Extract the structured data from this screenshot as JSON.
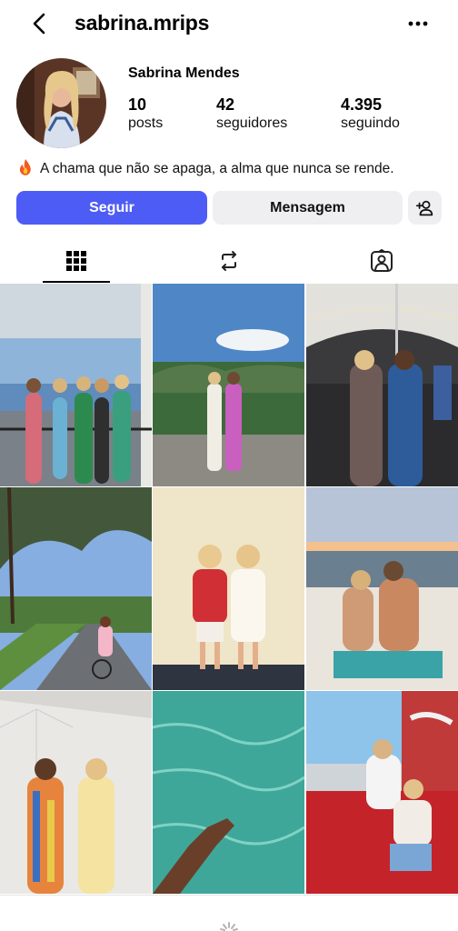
{
  "header": {
    "username": "sabrina.mrips",
    "back_icon": "chevron-left-icon",
    "more_icon": "more-horizontal-icon"
  },
  "profile": {
    "full_name": "Sabrina Mendes",
    "stats": [
      {
        "value": "10",
        "label": "posts"
      },
      {
        "value": "42",
        "label": "seguidores"
      },
      {
        "value": "4.395",
        "label": "seguindo"
      }
    ],
    "bio_emoji": "fire-icon",
    "bio": "A chama que não se apaga, a alma que nunca se rende."
  },
  "actions": {
    "follow_label": "Seguir",
    "message_label": "Mensagem",
    "add_icon": "add-person-icon",
    "follow_color": "#4d5cf5"
  },
  "tabs": [
    {
      "icon": "grid-icon",
      "active": true
    },
    {
      "icon": "reposts-icon",
      "active": false
    },
    {
      "icon": "tagged-icon",
      "active": false
    }
  ],
  "posts": [
    "group-of-women-on-balcony-photo",
    "two-women-on-rock-overlook-photo",
    "two-women-at-tent-party-photo",
    "woman-cycling-oak-road-photo",
    "two-women-against-wall-photo",
    "couple-on-boat-sunset-photo",
    "two-women-in-dresses-photo",
    "hand-over-clear-water-photo",
    "two-women-on-red-car-photo"
  ]
}
